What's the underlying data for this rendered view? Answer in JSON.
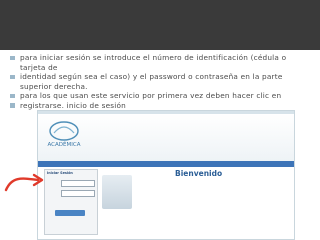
{
  "bullets": [
    {
      "text": "para iniciar sesión se introduce el número de identificación (cédula o tarjeta de"
    },
    {
      "text": "identidad según sea el caso) y el password o contraseña en la parte superior derecha."
    },
    {
      "text": "para los que usan este servicio por primera vez deben hacer clic en"
    },
    {
      "text": "registrarse. inicio de sesión"
    }
  ],
  "screenshot": {
    "logo_text": "ACADÉMICA",
    "login_title": "Iniciar Sesión",
    "welcome_title": "Bienvenido"
  },
  "colors": {
    "title_band": "#3a3a3a",
    "bullet": "#9bb7c9",
    "nav_bar": "#3d74b8",
    "arrow": "#e03a2b"
  }
}
